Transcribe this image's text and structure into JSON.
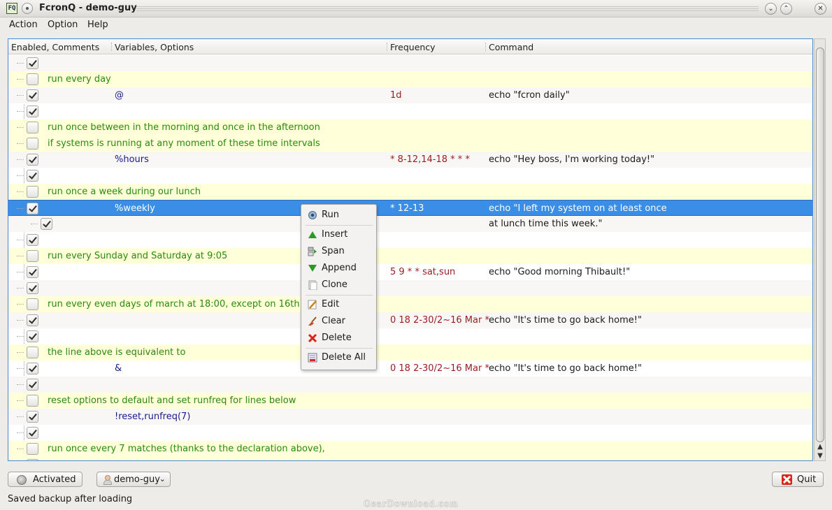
{
  "window": {
    "title": "FcronQ - demo-guy",
    "app_icon_text": "FQ"
  },
  "menubar": [
    "Action",
    "Option",
    "Help"
  ],
  "columns": [
    "Enabled, Comments",
    "Variables, Options",
    "Frequency",
    "Command"
  ],
  "rows": [
    {
      "type": "entry",
      "checked": true,
      "comment": "",
      "var": "",
      "freq": "",
      "cmd": ""
    },
    {
      "type": "comment",
      "checked": false,
      "comment": "run every day",
      "var": "",
      "freq": "",
      "cmd": ""
    },
    {
      "type": "entry",
      "checked": true,
      "comment": "",
      "var": "@",
      "freq": "1d",
      "cmd": "echo \"fcron daily\""
    },
    {
      "type": "entry",
      "checked": true,
      "comment": "",
      "var": "",
      "freq": "",
      "cmd": ""
    },
    {
      "type": "comment",
      "checked": false,
      "comment": "run once between in the morning and once in the afternoon",
      "var": "",
      "freq": "",
      "cmd": ""
    },
    {
      "type": "comment",
      "checked": false,
      "comment": " if systems is running at any moment of these time intervals",
      "var": "",
      "freq": "",
      "cmd": ""
    },
    {
      "type": "entry",
      "checked": true,
      "comment": "",
      "var": "%hours",
      "freq": "* 8-12,14-18 * * *",
      "cmd": "echo \"Hey boss, I'm working today!\""
    },
    {
      "type": "entry",
      "checked": true,
      "comment": "",
      "var": "",
      "freq": "",
      "cmd": ""
    },
    {
      "type": "comment",
      "checked": false,
      "comment": "run once a week during our lunch",
      "var": "",
      "freq": "",
      "cmd": ""
    },
    {
      "type": "selected",
      "checked": true,
      "comment": "",
      "var": "%weekly",
      "freq": "* 12-13",
      "cmd": "echo \"I left my system on at least once"
    },
    {
      "type": "child",
      "checked": true,
      "comment": "",
      "var": "",
      "freq": "",
      "cmd": " at lunch time this week.\""
    },
    {
      "type": "entry",
      "checked": true,
      "comment": "",
      "var": "",
      "freq": "",
      "cmd": ""
    },
    {
      "type": "comment",
      "checked": false,
      "comment": "run every Sunday and Saturday at 9:05",
      "var": "",
      "freq": "",
      "cmd": ""
    },
    {
      "type": "entry",
      "checked": true,
      "comment": "",
      "var": "",
      "freq": "5 9 * * sat,sun",
      "cmd": "echo \"Good morning Thibault!\""
    },
    {
      "type": "entry",
      "checked": true,
      "comment": "",
      "var": "",
      "freq": "",
      "cmd": ""
    },
    {
      "type": "comment",
      "checked": false,
      "comment": "run every even days of march at 18:00, except on 16th",
      "var": "",
      "freq": "",
      "cmd": ""
    },
    {
      "type": "entry",
      "checked": true,
      "comment": "",
      "var": "",
      "freq": "0 18 2-30/2~16 Mar *",
      "cmd": "echo \"It's time to go back home!\""
    },
    {
      "type": "entry",
      "checked": true,
      "comment": "",
      "var": "",
      "freq": "",
      "cmd": ""
    },
    {
      "type": "comment",
      "checked": false,
      "comment": "the line above is equivalent to",
      "var": "",
      "freq": "",
      "cmd": ""
    },
    {
      "type": "entry",
      "checked": true,
      "comment": "",
      "var": "&",
      "freq": "0 18 2-30/2~16 Mar *",
      "cmd": "echo \"It's time to go back home!\""
    },
    {
      "type": "entry",
      "checked": true,
      "comment": "",
      "var": "",
      "freq": "",
      "cmd": ""
    },
    {
      "type": "comment",
      "checked": false,
      "comment": "reset options to default and set runfreq for lines below",
      "var": "",
      "freq": "",
      "cmd": ""
    },
    {
      "type": "entry",
      "checked": true,
      "comment": "",
      "var": "!reset,runfreq(7)",
      "freq": "",
      "cmd": ""
    },
    {
      "type": "entry",
      "checked": true,
      "comment": "",
      "var": "",
      "freq": "",
      "cmd": ""
    },
    {
      "type": "comment",
      "checked": false,
      "comment": "run once every 7 matches (thanks to the declaration above),",
      "var": "",
      "freq": "",
      "cmd": ""
    },
    {
      "type": "comment",
      "checked": false,
      "comment": "",
      "var": "",
      "freq": "",
      "cmd": ""
    }
  ],
  "context_menu": {
    "items": [
      {
        "label": "Run",
        "icon": "gear-run-icon"
      },
      {
        "label": "Insert",
        "icon": "arrow-up-icon"
      },
      {
        "label": "Span",
        "icon": "span-icon"
      },
      {
        "label": "Append",
        "icon": "arrow-down-icon"
      },
      {
        "label": "Clone",
        "icon": "clone-icon"
      },
      {
        "label": "Edit",
        "icon": "pencil-icon"
      },
      {
        "label": "Clear",
        "icon": "broom-icon"
      },
      {
        "label": "Delete",
        "icon": "red-x-icon"
      },
      {
        "label": "Delete All",
        "icon": "delete-all-icon"
      }
    ]
  },
  "bottom": {
    "activated_label": "Activated",
    "user_label": "demo-guy",
    "quit_label": "Quit",
    "status": "Saved backup after loading",
    "watermark": "GearDownload.com"
  },
  "colors": {
    "comment": "#2a8a0e",
    "variable": "#1a1a8c",
    "frequency": "#9a1c1c",
    "selection": "#3a8ee6",
    "comment_row_bg": "#ffffd9"
  }
}
